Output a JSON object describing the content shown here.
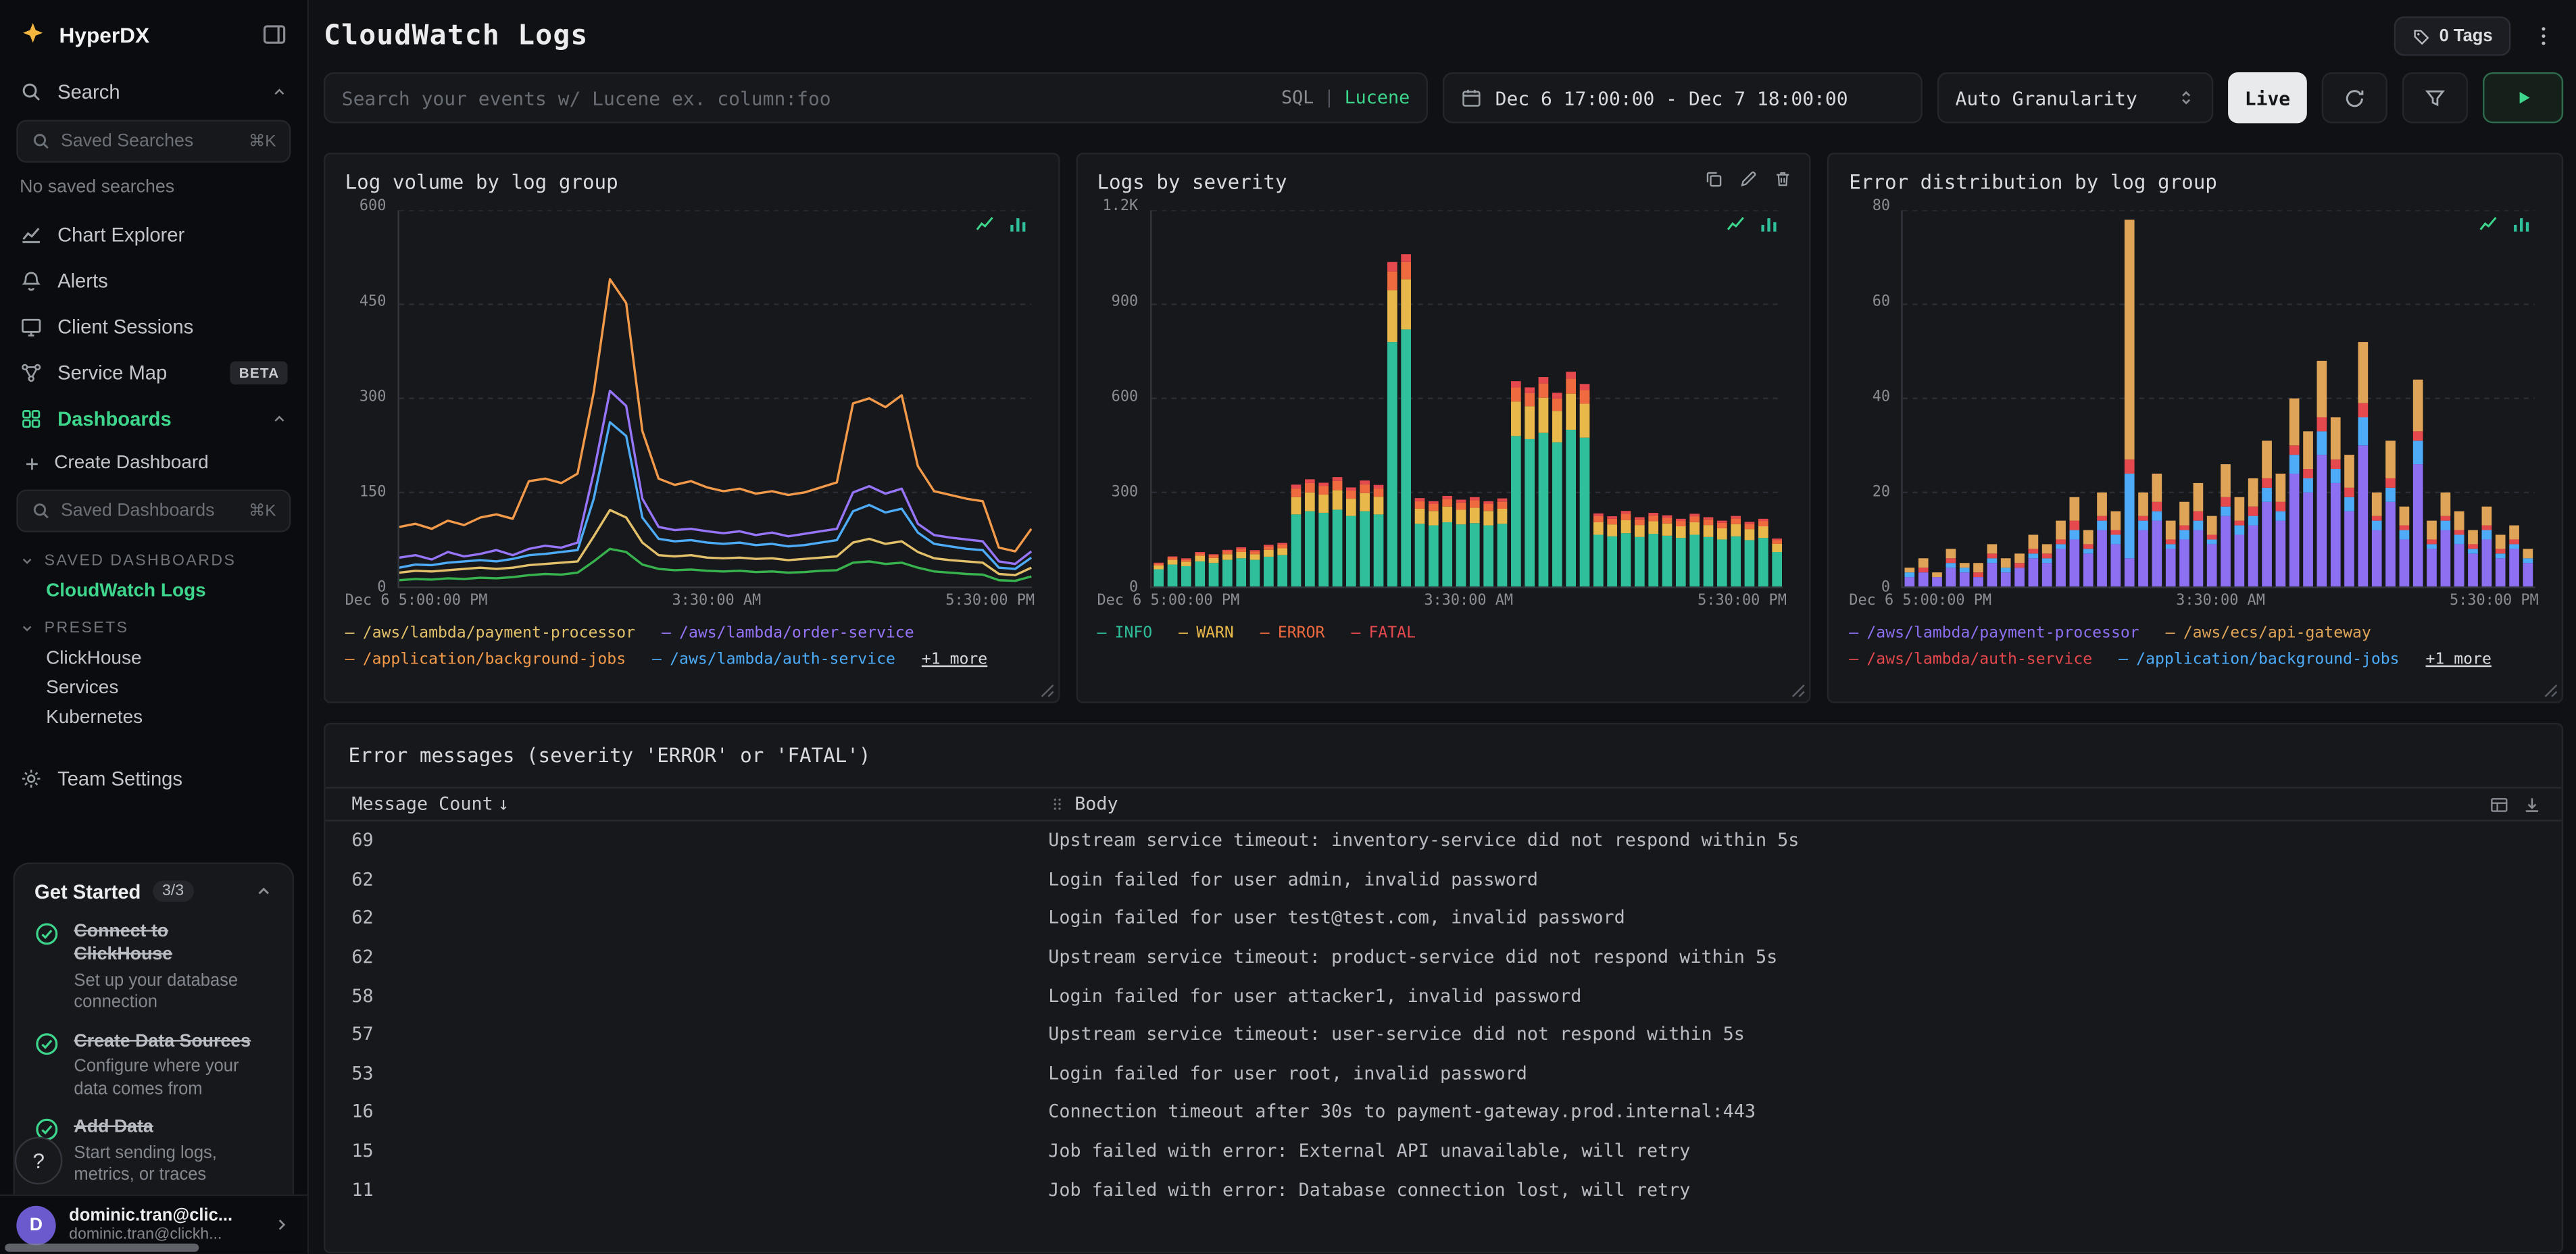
{
  "sidebar": {
    "logo": "HyperDX",
    "nav": [
      {
        "label": "Search"
      },
      {
        "label": "Chart Explorer"
      },
      {
        "label": "Alerts"
      },
      {
        "label": "Client Sessions"
      },
      {
        "label": "Service Map",
        "badge": "BETA"
      },
      {
        "label": "Dashboards"
      }
    ],
    "saved_searches_placeholder": "Saved Searches",
    "saved_searches_shortcut": "⌘K",
    "no_saved_searches": "No saved searches",
    "create_dashboard": "Create Dashboard",
    "saved_dashboards_placeholder": "Saved Dashboards",
    "saved_dashboards_shortcut": "⌘K",
    "sections": {
      "saved_dashboards": "SAVED DASHBOARDS",
      "presets": "PRESETS"
    },
    "saved_dashboard_items": [
      "CloudWatch Logs"
    ],
    "preset_items": [
      "ClickHouse",
      "Services",
      "Kubernetes"
    ],
    "team_settings": "Team Settings",
    "get_started": {
      "title": "Get Started",
      "progress": "3/3",
      "items": [
        {
          "title": "Connect to ClickHouse",
          "subtitle": "Set up your database connection"
        },
        {
          "title": "Create Data Sources",
          "subtitle": "Configure where your data comes from"
        },
        {
          "title": "Add Data",
          "subtitle": "Start sending logs, metrics, or traces"
        }
      ]
    },
    "help": "?",
    "user": {
      "initial": "D",
      "name": "dominic.tran@clic...",
      "email": "dominic.tran@clickh..."
    }
  },
  "header": {
    "title": "CloudWatch Logs",
    "tags_label": "0 Tags"
  },
  "toolbar": {
    "search_placeholder": "Search your events w/ Lucene ex. column:foo",
    "lang_sql": "SQL",
    "lang_sep": "|",
    "lang_lucene": "Lucene",
    "date_range": "Dec 6 17:00:00 - Dec 7 18:00:00",
    "granularity": "Auto Granularity",
    "live": "Live"
  },
  "chart_data": [
    {
      "type": "line",
      "title": "Log volume by log group",
      "ylim": [
        0,
        600
      ],
      "yticks_values": [
        0,
        150,
        300,
        450,
        600
      ],
      "yticks_labels": [
        "0",
        "150",
        "300",
        "450",
        "600"
      ],
      "xticks": [
        "Dec 6 5:00:00 PM",
        "3:30:00 AM",
        "5:30:00 PM"
      ],
      "grid": true,
      "legend": [
        {
          "label": "/aws/lambda/payment-processor",
          "color": "#e3c06a"
        },
        {
          "label": "/aws/lambda/order-service",
          "color": "#9775fa"
        },
        {
          "label": "/application/background-jobs",
          "color": "#f2994a"
        },
        {
          "label": "/aws/lambda/auth-service",
          "color": "#4dabf7"
        }
      ],
      "more": "+1 more",
      "series": [
        {
          "name": "/application/background-jobs",
          "color": "#f2994a",
          "values": [
            95,
            100,
            92,
            105,
            98,
            110,
            115,
            108,
            168,
            172,
            165,
            180,
            310,
            490,
            452,
            248,
            172,
            162,
            168,
            158,
            152,
            156,
            148,
            152,
            146,
            150,
            158,
            166,
            292,
            300,
            286,
            305,
            192,
            152,
            146,
            140,
            136,
            62,
            56,
            92
          ]
        },
        {
          "name": "/aws/lambda/order-service",
          "color": "#9775fa",
          "values": [
            46,
            50,
            43,
            55,
            48,
            52,
            58,
            50,
            60,
            65,
            62,
            70,
            182,
            312,
            288,
            140,
            95,
            90,
            92,
            88,
            85,
            88,
            82,
            86,
            80,
            84,
            88,
            92,
            150,
            160,
            148,
            156,
            100,
            82,
            78,
            75,
            72,
            40,
            36,
            56
          ]
        },
        {
          "name": "/aws/lambda/auth-service",
          "color": "#4dabf7",
          "values": [
            30,
            35,
            34,
            38,
            40,
            42,
            40,
            44,
            50,
            52,
            55,
            58,
            140,
            262,
            240,
            110,
            76,
            72,
            74,
            70,
            68,
            70,
            66,
            68,
            64,
            66,
            70,
            74,
            120,
            130,
            118,
            124,
            86,
            68,
            64,
            60,
            58,
            30,
            28,
            46
          ]
        },
        {
          "name": "/aws/lambda/payment-processor",
          "color": "#e3c06a",
          "values": [
            22,
            25,
            24,
            26,
            28,
            30,
            28,
            30,
            34,
            36,
            38,
            40,
            80,
            122,
            110,
            70,
            50,
            48,
            50,
            46,
            45,
            46,
            44,
            45,
            42,
            44,
            46,
            48,
            70,
            76,
            68,
            72,
            55,
            45,
            42,
            40,
            38,
            20,
            18,
            30
          ]
        },
        {
          "name": "other",
          "color": "#37b24d",
          "values": [
            10,
            12,
            11,
            13,
            12,
            14,
            13,
            15,
            18,
            20,
            19,
            22,
            40,
            60,
            55,
            35,
            28,
            26,
            27,
            25,
            24,
            25,
            23,
            24,
            22,
            23,
            25,
            26,
            38,
            40,
            36,
            38,
            30,
            24,
            22,
            20,
            19,
            10,
            9,
            16
          ]
        }
      ]
    },
    {
      "type": "stacked-bar",
      "title": "Logs by severity",
      "ylim": [
        0,
        1200
      ],
      "yticks_values": [
        0,
        300,
        600,
        900,
        1200
      ],
      "yticks_labels": [
        "0",
        "300",
        "600",
        "900",
        "1.2K"
      ],
      "xticks": [
        "Dec 6 5:00:00 PM",
        "3:30:00 AM",
        "5:30:00 PM"
      ],
      "grid": true,
      "legend": [
        {
          "label": "INFO",
          "color": "#2fbf9a"
        },
        {
          "label": "WARN",
          "color": "#e9b84a"
        },
        {
          "label": "ERROR",
          "color": "#f06a3f"
        },
        {
          "label": "FATAL",
          "color": "#e5484d"
        }
      ],
      "series": [
        {
          "name": "INFO",
          "color": "#2fbf9a"
        },
        {
          "name": "WARN",
          "color": "#e9b84a"
        },
        {
          "name": "ERROR",
          "color": "#f06a3f"
        },
        {
          "name": "FATAL",
          "color": "#e5484d"
        }
      ],
      "bars": [
        [
          55,
          12,
          6,
          3
        ],
        [
          70,
          15,
          8,
          3
        ],
        [
          65,
          14,
          7,
          4
        ],
        [
          80,
          18,
          8,
          4
        ],
        [
          75,
          16,
          9,
          3
        ],
        [
          85,
          18,
          10,
          4
        ],
        [
          90,
          20,
          10,
          5
        ],
        [
          85,
          18,
          9,
          4
        ],
        [
          95,
          22,
          11,
          5
        ],
        [
          100,
          22,
          12,
          5
        ],
        [
          230,
          55,
          28,
          12
        ],
        [
          240,
          60,
          30,
          12
        ],
        [
          235,
          58,
          28,
          10
        ],
        [
          245,
          62,
          30,
          12
        ],
        [
          225,
          55,
          26,
          10
        ],
        [
          240,
          58,
          28,
          12
        ],
        [
          230,
          56,
          27,
          11
        ],
        [
          780,
          165,
          60,
          30
        ],
        [
          820,
          160,
          55,
          25
        ],
        [
          200,
          48,
          24,
          10
        ],
        [
          195,
          46,
          22,
          9
        ],
        [
          205,
          50,
          24,
          10
        ],
        [
          198,
          47,
          23,
          9
        ],
        [
          202,
          49,
          24,
          10
        ],
        [
          195,
          46,
          22,
          9
        ],
        [
          200,
          48,
          23,
          10
        ],
        [
          480,
          110,
          45,
          20
        ],
        [
          470,
          105,
          42,
          18
        ],
        [
          490,
          112,
          46,
          20
        ],
        [
          460,
          100,
          40,
          18
        ],
        [
          500,
          115,
          48,
          22
        ],
        [
          475,
          108,
          44,
          19
        ],
        [
          165,
          40,
          20,
          8
        ],
        [
          160,
          38,
          18,
          8
        ],
        [
          170,
          42,
          20,
          9
        ],
        [
          158,
          38,
          18,
          7
        ],
        [
          168,
          40,
          19,
          8
        ],
        [
          162,
          39,
          18,
          8
        ],
        [
          155,
          37,
          17,
          7
        ],
        [
          165,
          40,
          19,
          8
        ],
        [
          158,
          38,
          18,
          7
        ],
        [
          150,
          36,
          17,
          7
        ],
        [
          160,
          39,
          18,
          8
        ],
        [
          148,
          35,
          16,
          7
        ],
        [
          155,
          37,
          17,
          7
        ],
        [
          110,
          26,
          12,
          5
        ]
      ]
    },
    {
      "type": "stacked-bar",
      "title": "Error distribution by log group",
      "ylim": [
        0,
        80
      ],
      "yticks_values": [
        0,
        20,
        40,
        60,
        80
      ],
      "yticks_labels": [
        "0",
        "20",
        "40",
        "60",
        "80"
      ],
      "xticks": [
        "Dec 6 5:00:00 PM",
        "3:30:00 AM",
        "5:30:00 PM"
      ],
      "grid": true,
      "legend": [
        {
          "label": "/aws/lambda/payment-processor",
          "color": "#8d6ff2"
        },
        {
          "label": "/aws/ecs/api-gateway",
          "color": "#e0a458"
        },
        {
          "label": "/aws/lambda/auth-service",
          "color": "#e5484d"
        },
        {
          "label": "/application/background-jobs",
          "color": "#4dabf7"
        }
      ],
      "more": "+1 more",
      "series": [
        {
          "name": "/aws/lambda/payment-processor",
          "color": "#8d6ff2"
        },
        {
          "name": "/application/background-jobs",
          "color": "#4dabf7"
        },
        {
          "name": "/aws/lambda/auth-service",
          "color": "#e5484d"
        },
        {
          "name": "/aws/ecs/api-gateway",
          "color": "#e0a458"
        }
      ],
      "bars": [
        [
          2,
          1,
          0,
          1
        ],
        [
          3,
          0,
          1,
          2
        ],
        [
          2,
          0,
          0,
          1
        ],
        [
          4,
          1,
          1,
          2
        ],
        [
          3,
          1,
          0,
          1
        ],
        [
          2,
          0,
          1,
          2
        ],
        [
          5,
          1,
          1,
          2
        ],
        [
          3,
          1,
          0,
          2
        ],
        [
          4,
          0,
          1,
          2
        ],
        [
          6,
          1,
          1,
          3
        ],
        [
          5,
          1,
          1,
          2
        ],
        [
          8,
          1,
          1,
          4
        ],
        [
          10,
          2,
          2,
          5
        ],
        [
          7,
          1,
          1,
          3
        ],
        [
          12,
          2,
          1,
          5
        ],
        [
          9,
          2,
          1,
          4
        ],
        [
          6,
          18,
          3,
          51
        ],
        [
          12,
          2,
          1,
          5
        ],
        [
          14,
          2,
          2,
          6
        ],
        [
          8,
          1,
          1,
          4
        ],
        [
          10,
          2,
          1,
          5
        ],
        [
          12,
          2,
          2,
          6
        ],
        [
          9,
          1,
          1,
          4
        ],
        [
          15,
          2,
          2,
          7
        ],
        [
          11,
          2,
          1,
          5
        ],
        [
          13,
          2,
          2,
          6
        ],
        [
          18,
          3,
          2,
          8
        ],
        [
          14,
          2,
          2,
          6
        ],
        [
          24,
          4,
          2,
          10
        ],
        [
          20,
          3,
          2,
          8
        ],
        [
          28,
          5,
          3,
          12
        ],
        [
          22,
          3,
          2,
          9
        ],
        [
          16,
          3,
          2,
          7
        ],
        [
          30,
          6,
          3,
          13
        ],
        [
          12,
          2,
          1,
          5
        ],
        [
          18,
          3,
          2,
          8
        ],
        [
          10,
          2,
          1,
          4
        ],
        [
          26,
          5,
          2,
          11
        ],
        [
          8,
          1,
          1,
          4
        ],
        [
          12,
          2,
          1,
          5
        ],
        [
          9,
          2,
          1,
          4
        ],
        [
          7,
          1,
          1,
          3
        ],
        [
          10,
          2,
          1,
          4
        ],
        [
          6,
          1,
          1,
          3
        ],
        [
          8,
          1,
          1,
          3
        ],
        [
          5,
          1,
          0,
          2
        ]
      ]
    }
  ],
  "table": {
    "title": "Error messages (severity 'ERROR' or 'FATAL')",
    "columns": [
      "Message Count",
      "Body"
    ],
    "sort_arrow": "↓",
    "rows": [
      {
        "count": "69",
        "body": "Upstream service timeout: inventory-service did not respond within 5s"
      },
      {
        "count": "62",
        "body": "Login failed for user admin, invalid password"
      },
      {
        "count": "62",
        "body": "Login failed for user test@test.com, invalid password"
      },
      {
        "count": "62",
        "body": "Upstream service timeout: product-service did not respond within 5s"
      },
      {
        "count": "58",
        "body": "Login failed for user attacker1, invalid password"
      },
      {
        "count": "57",
        "body": "Upstream service timeout: user-service did not respond within 5s"
      },
      {
        "count": "53",
        "body": "Login failed for user root, invalid password"
      },
      {
        "count": "16",
        "body": "Connection timeout after 30s to payment-gateway.prod.internal:443"
      },
      {
        "count": "15",
        "body": "Job failed with error: External API unavailable, will retry"
      },
      {
        "count": "11",
        "body": "Job failed with error: Database connection lost, will retry"
      }
    ]
  },
  "colors": {
    "accent_green": "#3dd68c",
    "background": "#101114",
    "card": "#16181c",
    "logo_yellow": "#f4b63f"
  }
}
